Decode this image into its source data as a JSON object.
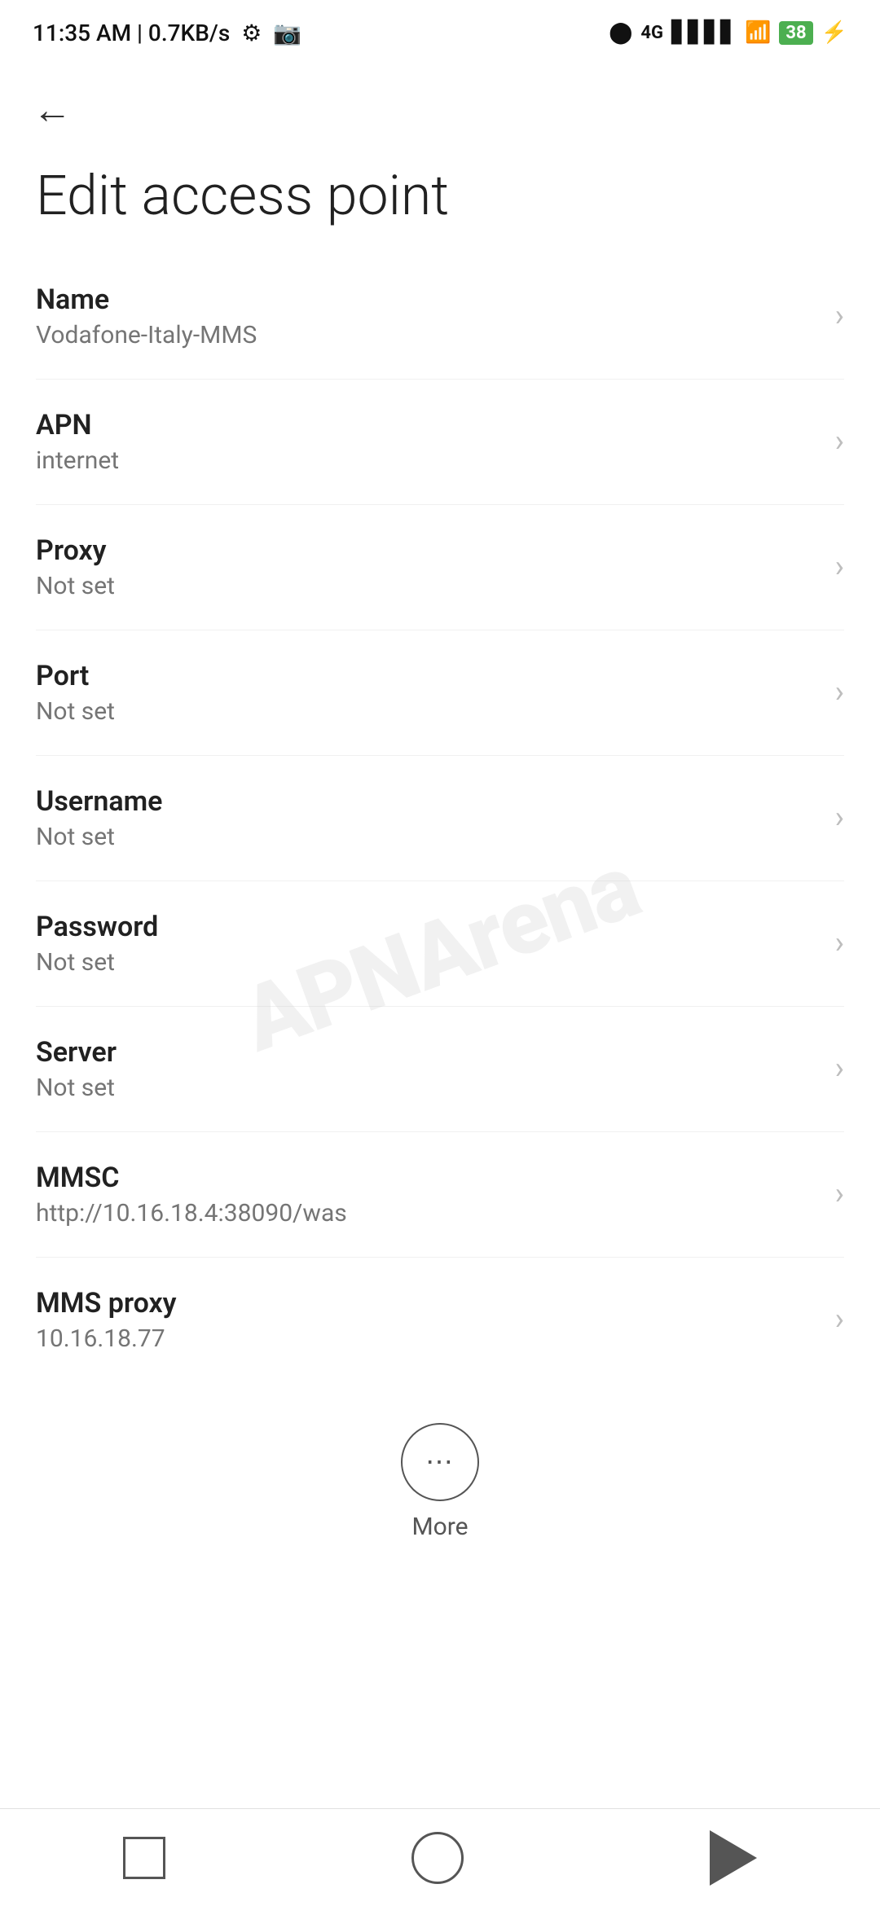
{
  "statusBar": {
    "time": "11:35 AM | 0.7KB/s",
    "batteryPercent": "38"
  },
  "navigation": {
    "backLabel": "←"
  },
  "page": {
    "title": "Edit access point"
  },
  "settings": [
    {
      "id": "name",
      "label": "Name",
      "value": "Vodafone-Italy-MMS"
    },
    {
      "id": "apn",
      "label": "APN",
      "value": "internet"
    },
    {
      "id": "proxy",
      "label": "Proxy",
      "value": "Not set"
    },
    {
      "id": "port",
      "label": "Port",
      "value": "Not set"
    },
    {
      "id": "username",
      "label": "Username",
      "value": "Not set"
    },
    {
      "id": "password",
      "label": "Password",
      "value": "Not set"
    },
    {
      "id": "server",
      "label": "Server",
      "value": "Not set"
    },
    {
      "id": "mmsc",
      "label": "MMSC",
      "value": "http://10.16.18.4:38090/was"
    },
    {
      "id": "mms-proxy",
      "label": "MMS proxy",
      "value": "10.16.18.77"
    }
  ],
  "more": {
    "label": "More"
  },
  "watermark": "APNArena"
}
